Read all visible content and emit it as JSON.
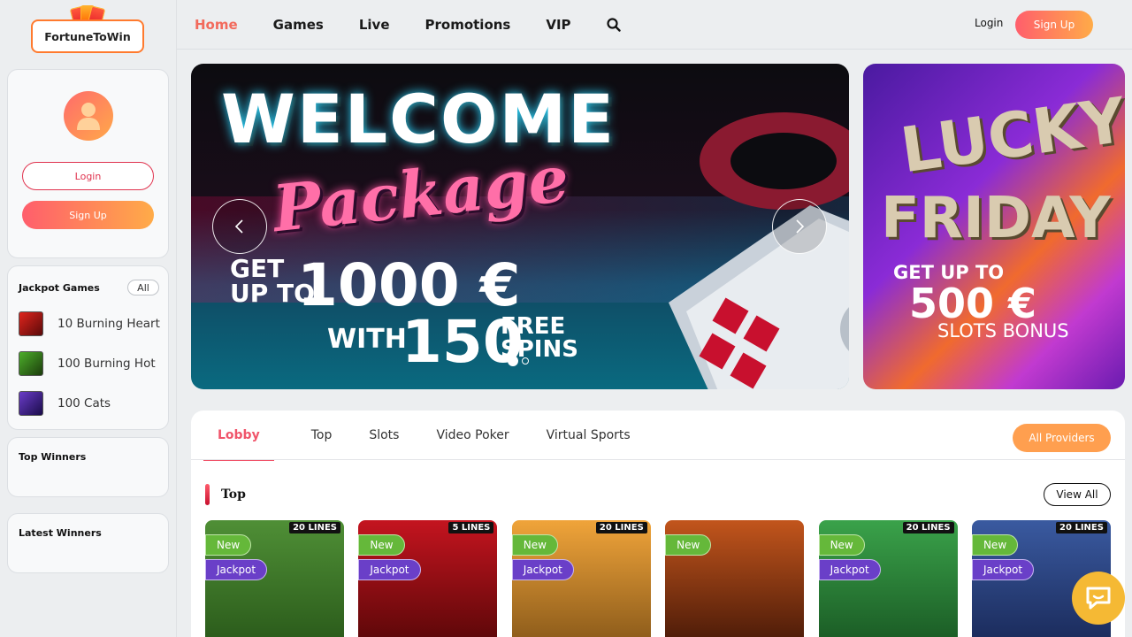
{
  "brand": {
    "name": "FortuneToWin"
  },
  "nav": {
    "items": [
      {
        "label": "Home",
        "active": true
      },
      {
        "label": "Games"
      },
      {
        "label": "Live"
      },
      {
        "label": "Promotions"
      },
      {
        "label": "VIP"
      }
    ],
    "search_icon": "search-icon",
    "login_label": "Login",
    "signup_label": "Sign Up"
  },
  "sidebar": {
    "user": {
      "login_label": "Login",
      "signup_label": "Sign Up"
    },
    "jackpot": {
      "title": "Jackpot Games",
      "all_label": "All",
      "items": [
        {
          "label": "10 Burning Heart",
          "color": "#b31b1b"
        },
        {
          "label": "100 Burning Hot",
          "color": "#2f7a1e"
        },
        {
          "label": "100 Cats",
          "color": "#3a2a7a"
        }
      ]
    },
    "top_winners_title": "Top Winners",
    "latest_winners_title": "Latest Winners"
  },
  "banners": {
    "main": {
      "title": "WELCOME",
      "subtitle": "Package",
      "line1a": "GET",
      "line1b": "UP TO",
      "amount": "1000 €",
      "with": "WITH",
      "spins": "150",
      "free1": "FREE",
      "free2": "SPINS"
    },
    "side": {
      "line1": "LUCKY",
      "line2": "FRIDAY",
      "get": "GET UP TO",
      "amount": "500 €",
      "bonus": "SLOTS BONUS"
    },
    "active_slide": 1,
    "slide_count": 2
  },
  "lobby": {
    "tabs": [
      {
        "label": "Lobby",
        "active": true
      },
      {
        "label": "Top"
      },
      {
        "label": "Slots"
      },
      {
        "label": "Video Poker"
      },
      {
        "label": "Virtual Sports"
      }
    ],
    "providers_label": "All Providers",
    "section_title": "Top",
    "view_all_label": "View All",
    "games": [
      {
        "lines": "20 LINES",
        "new": "New",
        "jackpot": "Jackpot",
        "bg": "#3d7a2a"
      },
      {
        "lines": "5 LINES",
        "new": "New",
        "jackpot": "Jackpot",
        "bg": "#a3121b"
      },
      {
        "lines": "20 LINES",
        "new": "New",
        "jackpot": "Jackpot",
        "bg": "#d9821f"
      },
      {
        "lines": "",
        "new": "New",
        "jackpot": "",
        "bg": "#7a2a10"
      },
      {
        "lines": "20 LINES",
        "new": "New",
        "jackpot": "Jackpot",
        "bg": "#2e8a3a"
      },
      {
        "lines": "20 LINES",
        "new": "New",
        "jackpot": "Jackpot",
        "bg": "#2a4a8a"
      }
    ]
  },
  "colors": {
    "accent": "#f26a5c",
    "gradient_start": "#ff5e6c",
    "gradient_end": "#ffab48",
    "chat": "#f5b934"
  }
}
